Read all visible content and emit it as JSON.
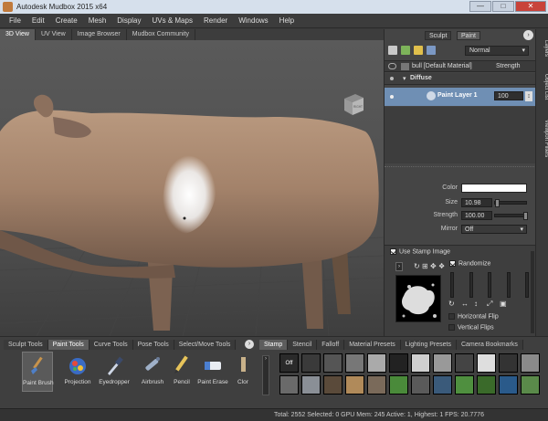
{
  "window": {
    "title": "Autodesk Mudbox 2015 x64",
    "min": "—",
    "max": "□",
    "close": "✕"
  },
  "menu": [
    "File",
    "Edit",
    "Create",
    "Mesh",
    "Display",
    "UVs & Maps",
    "Render",
    "Windows",
    "Help"
  ],
  "view_tabs": [
    "3D View",
    "UV View",
    "Image Browser",
    "Mudbox Community"
  ],
  "view_cube_label": "RIGHT",
  "panel": {
    "mode_tabs": [
      "Sculpt",
      "Paint"
    ],
    "blend_mode": "Normal",
    "material": "bull [Default Material]",
    "strength_header": "Strength",
    "channel": "Diffuse",
    "layer_name": "Paint Layer 1",
    "layer_strength": "100",
    "side_tabs": [
      "Layers",
      "Object List",
      "Viewport Filters"
    ],
    "props": {
      "color_label": "Color",
      "size_label": "Size",
      "size_value": "10.98",
      "strength_label": "Strength",
      "strength_value": "100.00",
      "mirror_label": "Mirror",
      "mirror_value": "Off",
      "use_stamp_label": "Use Stamp Image",
      "randomize_label": "Randomize",
      "hflip_label": "Horizontal Flip",
      "vflip_label": "Vertical Flips"
    }
  },
  "tool_tabs": [
    "Sculpt Tools",
    "Paint Tools",
    "Curve Tools",
    "Pose Tools",
    "Select/Move Tools"
  ],
  "tools": [
    "Paint Brush",
    "Projection",
    "Eyedropper",
    "Airbrush",
    "Pencil",
    "Paint Erase",
    "Clor"
  ],
  "tool_icons": [
    "paint-brush-icon",
    "projection-icon",
    "eyedropper-icon",
    "airbrush-icon",
    "pencil-icon",
    "paint-erase-icon",
    "clone-icon"
  ],
  "stamp_tabs": [
    "Stamp",
    "Stencil",
    "Falloff",
    "Material Presets",
    "Lighting Presets",
    "Camera Bookmarks"
  ],
  "stamp_off": "Off",
  "status": "Total: 2552  Selected: 0 GPU Mem: 245  Active: 1, Highest: 1  FPS: 20.7776",
  "colors": {
    "accent": "#6d8fb8",
    "model": "#9a7c68",
    "layer_sel": "#6f8fb4"
  }
}
